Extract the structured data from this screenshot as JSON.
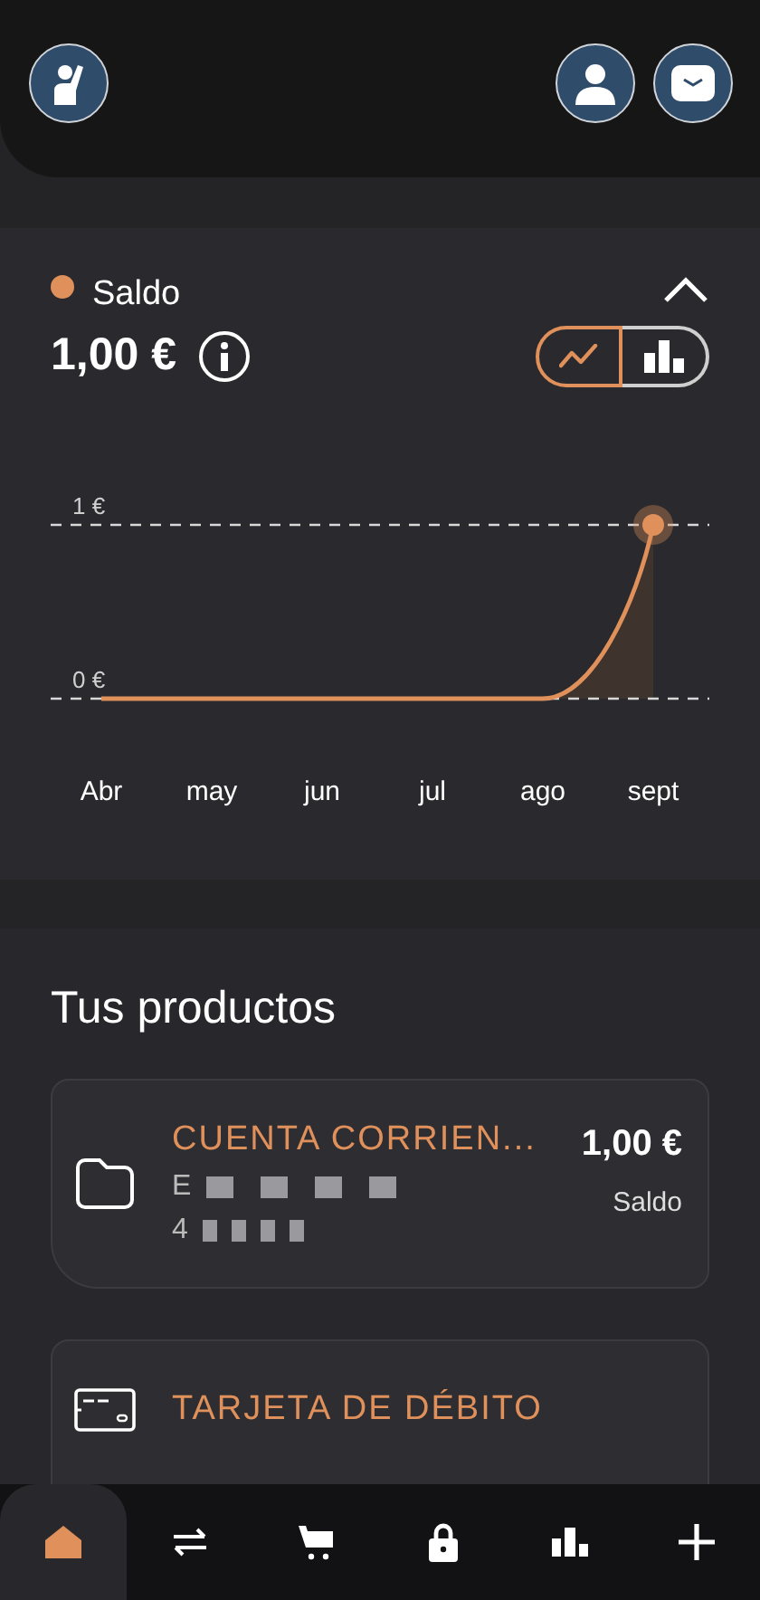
{
  "header": {
    "left_buttons": [
      {
        "kind": "wave"
      }
    ],
    "right_buttons": [
      {
        "kind": "profile"
      },
      {
        "kind": "mail"
      }
    ]
  },
  "balance": {
    "label": "Saldo",
    "color": "#e0905a",
    "amount": "1,00 €",
    "expanded": true,
    "view_toggle": [
      {
        "kind": "line",
        "selected": true
      },
      {
        "kind": "bar",
        "selected": false
      }
    ],
    "chart_data": {
      "type": "line",
      "categories": [
        "Abr",
        "may",
        "jun",
        "jul",
        "ago",
        "sept"
      ],
      "series": [
        {
          "color": "#e0905a",
          "values": [
            0,
            0,
            0,
            0,
            0,
            1
          ]
        }
      ],
      "ylim": [
        0,
        1
      ],
      "yticks": [
        {
          "value": 0,
          "label": "0 €"
        },
        {
          "value": 1,
          "label": "1 €"
        }
      ]
    }
  },
  "products": {
    "title": "Tus productos",
    "items": [
      {
        "kind": "account",
        "name": "CUENTA CORRIEN...",
        "line_1": "E",
        "line_2": "4",
        "amount": "1,00 €",
        "amount_label": "Saldo"
      },
      {
        "kind": "card",
        "name": "TARJETA DE DÉBITO"
      }
    ]
  },
  "nav": [
    {
      "kind": "home",
      "selected": true
    },
    {
      "kind": "transfer",
      "selected": false
    },
    {
      "kind": "cart",
      "selected": false
    },
    {
      "kind": "lock",
      "selected": false
    },
    {
      "kind": "stats",
      "selected": false
    },
    {
      "kind": "add",
      "selected": false
    }
  ]
}
